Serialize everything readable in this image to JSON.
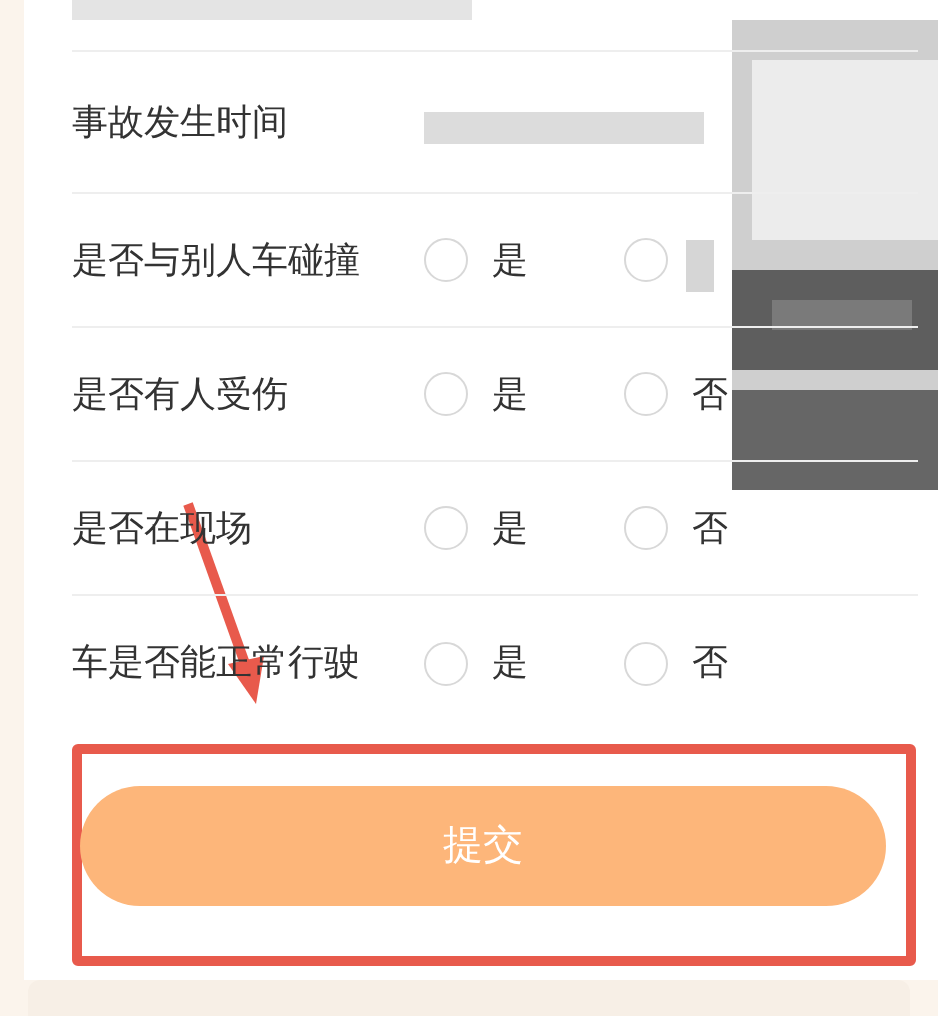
{
  "form": {
    "rows": [
      {
        "kind": "value",
        "label": "事故发生时间"
      },
      {
        "kind": "choice",
        "label": "是否与别人车碰撞",
        "options": [
          {
            "label": "是",
            "selected": false
          },
          {
            "selected": false
          }
        ]
      },
      {
        "kind": "choice",
        "label": "是否有人受伤",
        "options": [
          {
            "label": "是",
            "selected": false
          },
          {
            "label": "否",
            "selected": false
          }
        ]
      },
      {
        "kind": "choice",
        "label": "是否在现场",
        "options": [
          {
            "label": "是",
            "selected": false
          },
          {
            "label": "否",
            "selected": false
          }
        ]
      },
      {
        "kind": "choice",
        "label": "车是否能正常行驶",
        "options": [
          {
            "label": "是",
            "selected": false
          },
          {
            "label": "否",
            "selected": false
          }
        ]
      }
    ]
  },
  "submit_button": {
    "label": "提交"
  }
}
